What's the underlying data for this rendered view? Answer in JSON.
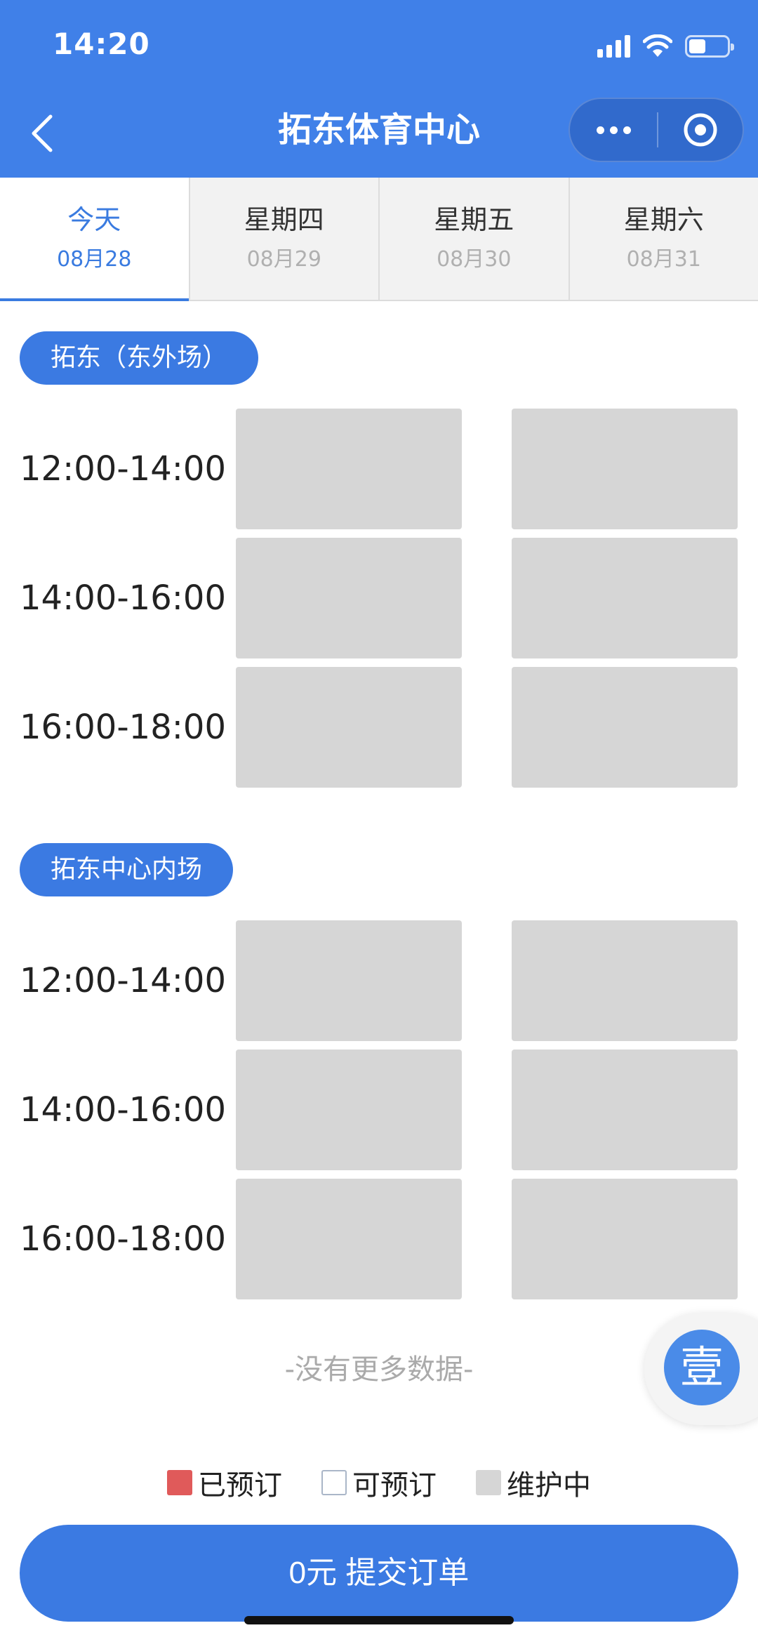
{
  "status_bar": {
    "time": "14:20"
  },
  "nav": {
    "title": "拓东体育中心"
  },
  "date_tabs": [
    {
      "day": "今天",
      "date": "08月28",
      "active": true
    },
    {
      "day": "星期四",
      "date": "08月29",
      "active": false
    },
    {
      "day": "星期五",
      "date": "08月30",
      "active": false
    },
    {
      "day": "星期六",
      "date": "08月31",
      "active": false
    }
  ],
  "venues": [
    {
      "name": "拓东（东外场）",
      "slots": [
        {
          "time": "12:00-14:00",
          "courts": [
            "maintenance",
            "maintenance"
          ]
        },
        {
          "time": "14:00-16:00",
          "courts": [
            "maintenance",
            "maintenance"
          ]
        },
        {
          "time": "16:00-18:00",
          "courts": [
            "maintenance",
            "maintenance"
          ]
        }
      ]
    },
    {
      "name": "拓东中心内场",
      "slots": [
        {
          "time": "12:00-14:00",
          "courts": [
            "maintenance",
            "maintenance"
          ]
        },
        {
          "time": "14:00-16:00",
          "courts": [
            "maintenance",
            "maintenance"
          ]
        },
        {
          "time": "16:00-18:00",
          "courts": [
            "maintenance",
            "maintenance"
          ]
        }
      ]
    }
  ],
  "no_more_text": "-没有更多数据-",
  "float_badge": {
    "char": "壹"
  },
  "legend": {
    "booked": "已预订",
    "available": "可预订",
    "maintenance": "维护中"
  },
  "submit": {
    "label": "0元 提交订单"
  },
  "colors": {
    "primary": "#3b7ae2",
    "booked": "#e05a5a",
    "maintenance": "#d6d6d6"
  }
}
